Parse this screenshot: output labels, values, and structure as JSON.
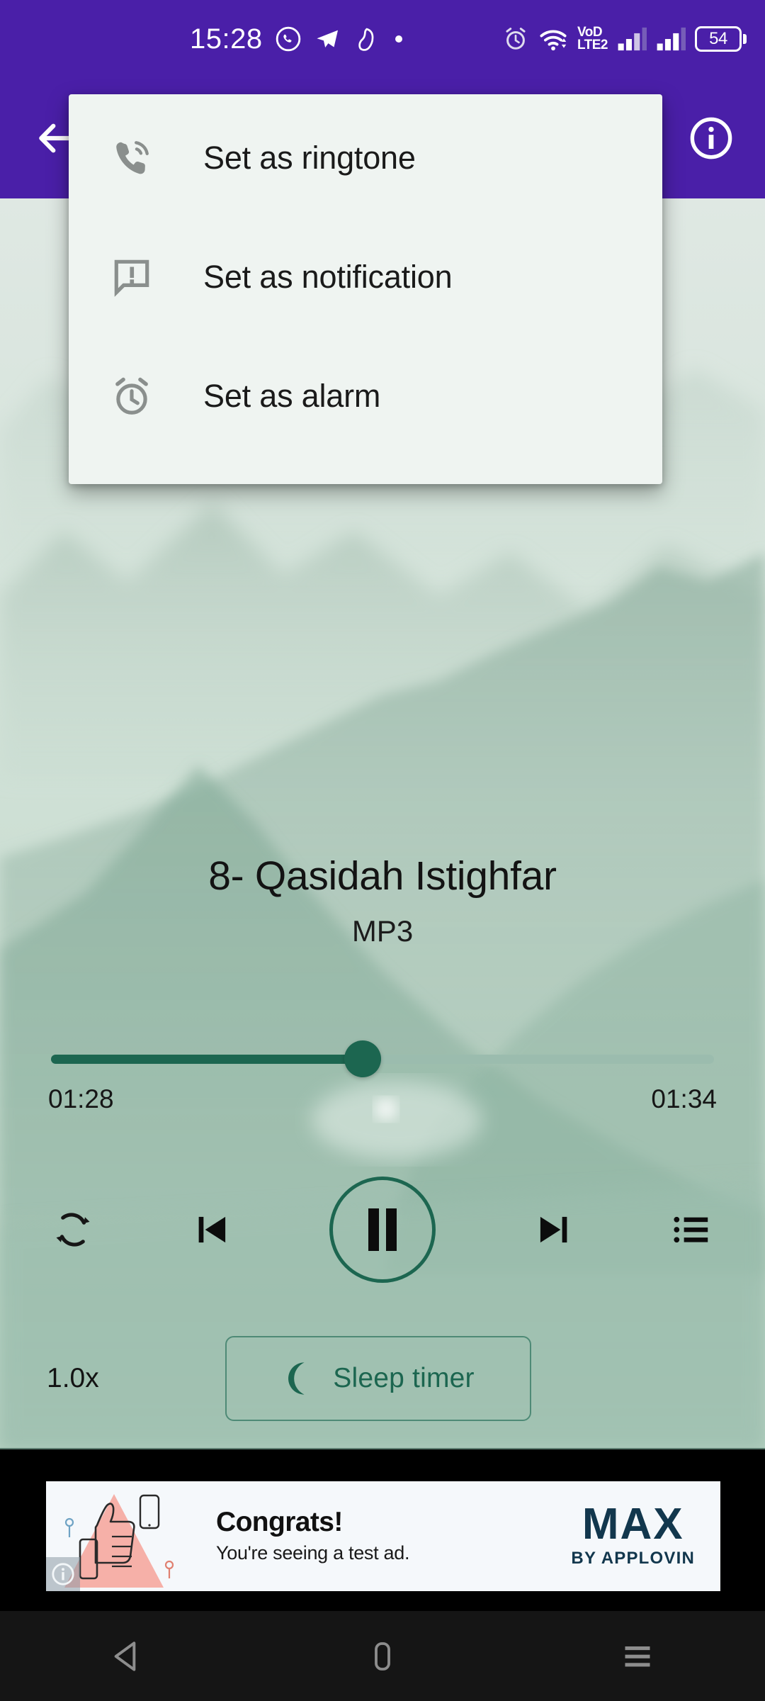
{
  "status_bar": {
    "time": "15:28",
    "battery_level": "54",
    "volte_line1": "VoD",
    "volte_line2": "LTE2",
    "icons": [
      "whatsapp-icon",
      "telegram-icon",
      "app-notification-icon",
      "dot-indicator-icon",
      "alarm-icon",
      "wifi-icon",
      "volte-icon",
      "signal-sim1-icon",
      "signal-sim2-icon",
      "battery-icon"
    ],
    "background_color": "#4A1FA8"
  },
  "app_bar": {
    "back_icon": "arrow-left-icon",
    "info_icon": "info-circle-icon",
    "background_color": "#4A1FA8"
  },
  "popup_menu": {
    "items": [
      {
        "label": "Set as ringtone",
        "icon": "ringtone-phone-icon"
      },
      {
        "label": "Set as notification",
        "icon": "notification-message-icon"
      },
      {
        "label": "Set as alarm",
        "icon": "alarm-clock-icon"
      }
    ]
  },
  "player": {
    "artwork_icon": "music-note-icon",
    "title": "8- Qasidah Istighfar",
    "subtitle": "MP3",
    "elapsed_time": "01:28",
    "total_time": "01:34",
    "progress_percent": 47,
    "accent_color": "#1c6650",
    "controls": [
      {
        "name": "repeat-button",
        "icon": "repeat-icon"
      },
      {
        "name": "previous-button",
        "icon": "skip-previous-icon"
      },
      {
        "name": "play-pause-button",
        "icon": "pause-icon"
      },
      {
        "name": "next-button",
        "icon": "skip-next-icon"
      },
      {
        "name": "playlist-button",
        "icon": "playlist-queue-icon"
      }
    ],
    "speed_label": "1.0x",
    "sleep_timer_label": "Sleep timer",
    "sleep_timer_icon": "crescent-moon-icon"
  },
  "ad": {
    "headline": "Congrats!",
    "subtext": "You're seeing a test ad.",
    "brand_name": "MAX",
    "brand_sub": "BY APPLOVIN",
    "info_icon": "ad-info-icon",
    "art_icon": "thumbs-up-icon"
  },
  "nav_bar": {
    "back": "nav-back-icon",
    "home": "nav-home-icon",
    "recents": "nav-recents-icon"
  }
}
